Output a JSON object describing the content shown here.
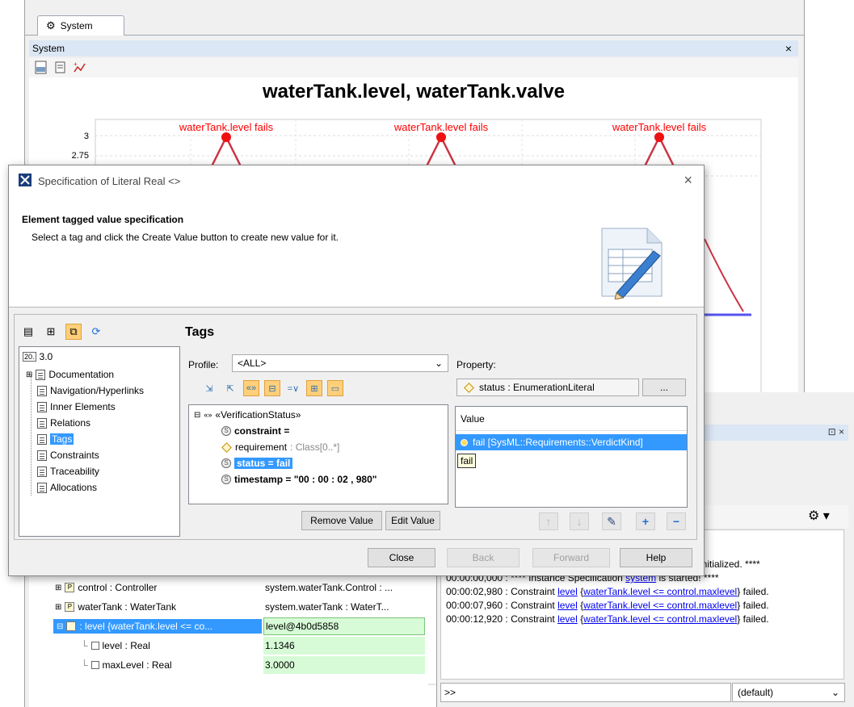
{
  "system_window": {
    "tab_label": "System",
    "panel_title": "System",
    "close_glyph": "×",
    "toolbar_icons": [
      "csv-icon",
      "report-icon",
      "plot-icon"
    ]
  },
  "chart_data": {
    "type": "line",
    "title": "waterTank.level, waterTank.valve",
    "y_ticks": [
      "3",
      "2.75"
    ],
    "annotations": [
      "waterTank.level fails",
      "waterTank.level fails",
      "waterTank.level fails"
    ],
    "colors": {
      "level": "#cc3344",
      "valve": "#5555ee",
      "annotation": "#ff0000"
    }
  },
  "dialog": {
    "title": "Specification of Literal Real <>",
    "close_glyph": "×",
    "header_title": "Element tagged value specification",
    "header_desc": "Select a tag and click the Create Value button to create new value for it.",
    "tree": {
      "root": "3.0",
      "items": [
        "Documentation",
        "Navigation/Hyperlinks",
        "Inner Elements",
        "Relations",
        "Tags",
        "Constraints",
        "Traceability",
        "Allocations"
      ],
      "selected": "Tags"
    },
    "tags_title": "Tags",
    "profile_label": "Profile:",
    "profile_value": "<ALL>",
    "tag_tree": {
      "stereotype": "«VerificationStatus»",
      "rows": [
        {
          "name": "constraint =",
          "bold": true
        },
        {
          "name": "requirement",
          "type": " : Class[0..*]"
        },
        {
          "name": "status = fail",
          "selected": true
        },
        {
          "name": "timestamp = \"00 : 00 : 02 , 980\"",
          "bold": true
        }
      ]
    },
    "remove_value": "Remove Value",
    "edit_value": "Edit Value",
    "property_label": "Property:",
    "property_value": "status : EnumerationLiteral",
    "property_more": "...",
    "value_header": "Value",
    "value_row": "fail [SysML::Requirements::VerdictKind]",
    "value_tooltip": "fail",
    "buttons": {
      "close": "Close",
      "back": "Back",
      "forward": "Forward",
      "help": "Help"
    }
  },
  "instance_tree": {
    "rows": [
      {
        "name": "control : Controller",
        "value": "system.waterTank.Control : ..."
      },
      {
        "name": "waterTank : WaterTank",
        "value": "system.waterTank : WaterT..."
      },
      {
        "name": ": level {waterTank.level <= co...",
        "value": "level@4b0d5858",
        "selected": true
      },
      {
        "name": "level : Real",
        "value": "1.1346"
      },
      {
        "name": "maxLevel : Real",
        "value": "3.0000"
      }
    ]
  },
  "console": {
    "header_controls": "⊡ ×",
    "gear": "⚙ ▾",
    "log_first": "is initialized. ****",
    "log_started": "00:00:00,000 : **** Instance Specification ",
    "log_started_link": "system",
    "log_started_end": " is started! ****",
    "failures": [
      {
        "time": "00:00:02,980 : Constraint ",
        "link1": "level",
        "link2": "waterTank.level <= control.maxlevel",
        "end": " failed."
      },
      {
        "time": "00:00:07,960 : Constraint ",
        "link1": "level",
        "link2": "waterTank.level <= control.maxlevel",
        "end": " failed."
      },
      {
        "time": "00:00:12,920 : Constraint ",
        "link1": "level",
        "link2": "waterTank.level <= control.maxlevel",
        "end": " failed."
      }
    ],
    "prompt": ">>",
    "select_value": "(default)"
  }
}
